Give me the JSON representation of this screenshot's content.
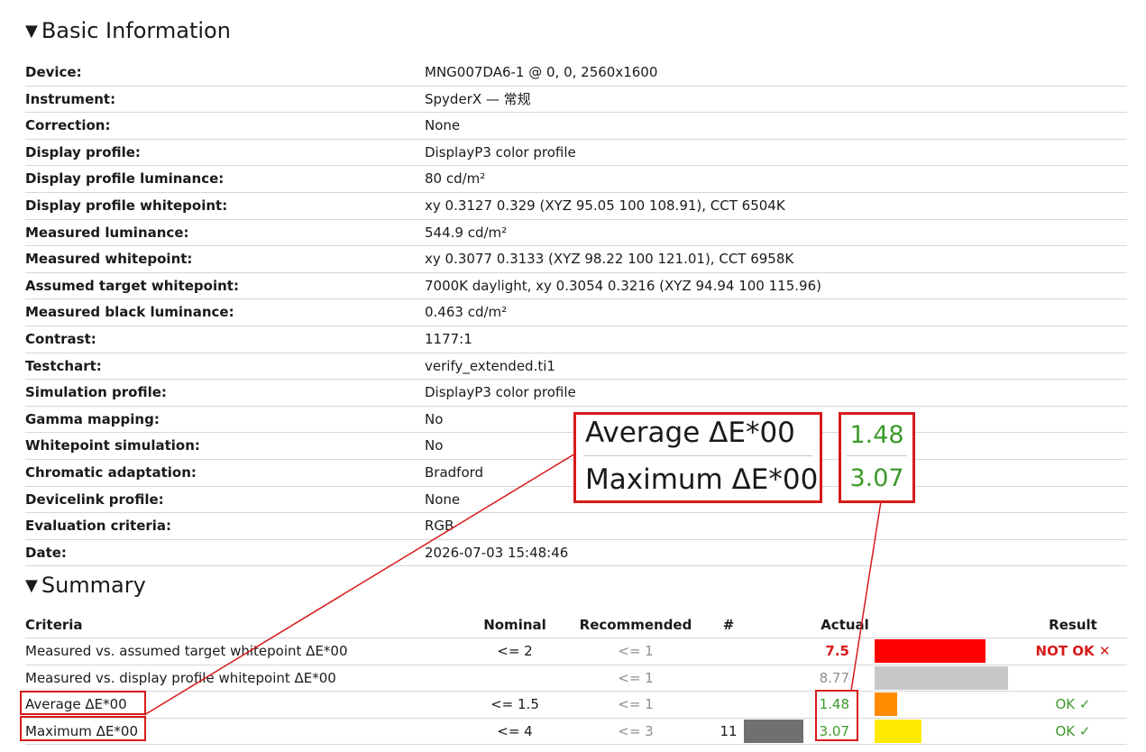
{
  "basic": {
    "title": "Basic Information",
    "rows": [
      {
        "label": "Device:",
        "value": "MNG007DA6-1 @ 0, 0, 2560x1600"
      },
      {
        "label": "Instrument:",
        "value": "SpyderX — 常规"
      },
      {
        "label": "Correction:",
        "value": "None"
      },
      {
        "label": "Display profile:",
        "value": "DisplayP3 color profile"
      },
      {
        "label": "Display profile luminance:",
        "value": "80 cd/m²"
      },
      {
        "label": "Display profile whitepoint:",
        "value": "xy 0.3127 0.329 (XYZ 95.05 100 108.91), CCT 6504K"
      },
      {
        "label": "Measured luminance:",
        "value": "544.9 cd/m²"
      },
      {
        "label": "Measured whitepoint:",
        "value": "xy 0.3077 0.3133 (XYZ 98.22 100 121.01), CCT 6958K"
      },
      {
        "label": "Assumed target whitepoint:",
        "value": "7000K daylight, xy 0.3054 0.3216 (XYZ 94.94 100 115.96)"
      },
      {
        "label": "Measured black luminance:",
        "value": "0.463 cd/m²"
      },
      {
        "label": "Contrast:",
        "value": "1177:1"
      },
      {
        "label": "Testchart:",
        "value": "verify_extended.ti1"
      },
      {
        "label": "Simulation profile:",
        "value": "DisplayP3 color profile"
      },
      {
        "label": "Gamma mapping:",
        "value": "No"
      },
      {
        "label": "Whitepoint simulation:",
        "value": "No"
      },
      {
        "label": "Chromatic adaptation:",
        "value": "Bradford"
      },
      {
        "label": "Devicelink profile:",
        "value": "None"
      },
      {
        "label": "Evaluation criteria:",
        "value": "RGB"
      },
      {
        "label": "Date:",
        "value": "2026-07-03 15:48:46"
      }
    ]
  },
  "summary": {
    "title": "Summary",
    "headers": {
      "criteria": "Criteria",
      "nominal": "Nominal",
      "recommended": "Recommended",
      "count": "#",
      "actual": "Actual",
      "result": "Result"
    },
    "rows": [
      {
        "criteria": "Measured vs. assumed target whitepoint ΔE*00",
        "nominal": "<= 2",
        "recommended": "<= 1",
        "count": "",
        "actual": "7.5",
        "actual_color": "#d71a1a",
        "bar_color": "#ff0000",
        "bar_level": 0.83,
        "result": "NOT OK ✕",
        "result_color": "#d71a1a"
      },
      {
        "criteria": "Measured vs. display profile whitepoint ΔE*00",
        "nominal": "",
        "recommended": "<= 1",
        "count": "",
        "actual": "8.77",
        "actual_color": "#8f8f8f",
        "bar_color": "#c8c8c8",
        "bar_level": 1.0,
        "result": "",
        "result_color": "#3c9a2a"
      },
      {
        "criteria": "Average ΔE*00",
        "nominal": "<= 1.5",
        "recommended": "<= 1",
        "count": "",
        "actual": "1.48",
        "actual_color": "#3c9a2a",
        "bar_color": "#ff8c00",
        "bar_level": 0.17,
        "result": "OK ✓",
        "result_color": "#3c9a2a"
      },
      {
        "criteria": "Maximum ΔE*00",
        "nominal": "<= 4",
        "recommended": "<= 3",
        "count": "11",
        "actual": "3.07",
        "actual_color": "#3c9a2a",
        "bar_color": "#ffeb00",
        "bar_level": 0.35,
        "result": "OK ✓",
        "result_color": "#3c9a2a"
      }
    ]
  },
  "zoom": {
    "average_label": "Average ΔE*00",
    "maximum_label": "Maximum ΔE*00",
    "average_value": "1.48",
    "maximum_value": "3.07",
    "value_color": "#3c9a2a",
    "annotation_color": "#d71a1a"
  }
}
